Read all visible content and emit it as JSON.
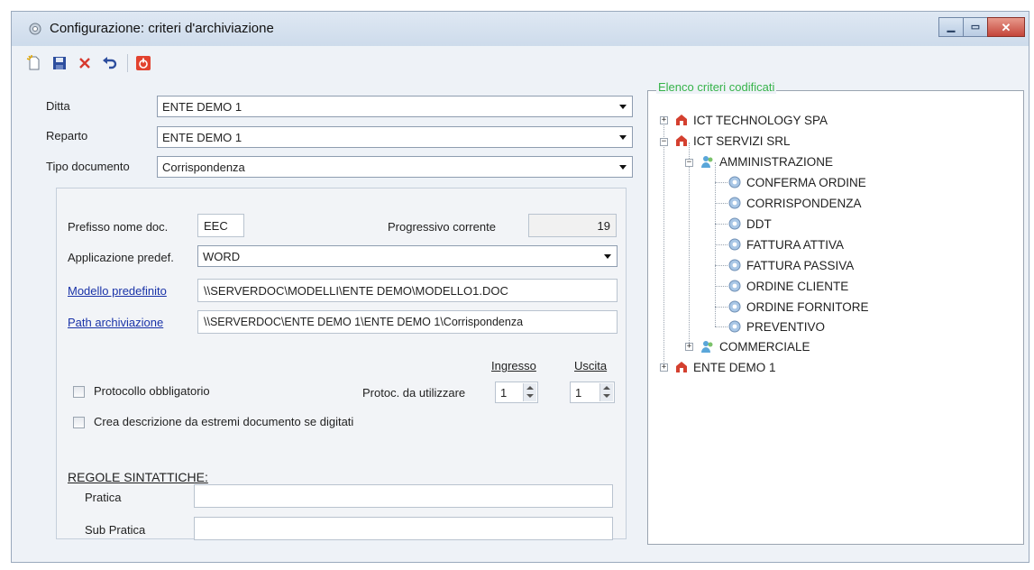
{
  "window": {
    "title": "Configurazione: criteri d'archiviazione"
  },
  "toolbar": {
    "icons": [
      "new-icon",
      "save-icon",
      "delete-icon",
      "undo-icon",
      "exit-icon"
    ]
  },
  "form": {
    "ditta": {
      "label": "Ditta",
      "value": "ENTE DEMO 1"
    },
    "reparto": {
      "label": "Reparto",
      "value": "ENTE DEMO 1"
    },
    "tipo_documento": {
      "label": "Tipo documento",
      "value": "Corrispondenza"
    }
  },
  "details": {
    "prefisso": {
      "label": "Prefisso nome doc.",
      "value": "EEC"
    },
    "progressivo": {
      "label": "Progressivo corrente",
      "value": "19"
    },
    "applicazione": {
      "label": "Applicazione predef.",
      "value": "WORD"
    },
    "modello": {
      "label": "Modello predefinito",
      "value": "\\\\SERVERDOC\\MODELLI\\ENTE DEMO\\MODELLO1.DOC"
    },
    "path": {
      "label": "Path archiviazione",
      "value": "\\\\SERVERDOC\\ENTE DEMO 1\\ENTE DEMO 1\\Corrispondenza"
    },
    "protocollo": {
      "label": "Protocollo obbligatorio",
      "checked": false
    },
    "protoc_utilizzare": {
      "label": "Protoc. da utilizzare",
      "ingresso_header": "Ingresso",
      "uscita_header": "Uscita",
      "ingresso_value": "1",
      "uscita_value": "1"
    },
    "crea_descrizione": {
      "label": "Crea descrizione da estremi documento se digitati",
      "checked": false
    },
    "regole": {
      "title": "REGOLE SINTATTICHE:",
      "pratica_label": "Pratica",
      "pratica_value": "",
      "sub_pratica_label": "Sub Pratica",
      "sub_pratica_value": ""
    }
  },
  "tree": {
    "title": "Elenco criteri codificati",
    "title_color": "#36b34a",
    "nodes": [
      {
        "label": "ICT TECHNOLOGY SPA"
      },
      {
        "label": "ICT SERVIZI SRL"
      },
      {
        "label": "AMMINISTRAZIONE"
      },
      {
        "label": "CONFERMA ORDINE"
      },
      {
        "label": "CORRISPONDENZA"
      },
      {
        "label": "DDT"
      },
      {
        "label": "FATTURA ATTIVA"
      },
      {
        "label": "FATTURA PASSIVA"
      },
      {
        "label": "ORDINE CLIENTE"
      },
      {
        "label": "ORDINE FORNITORE"
      },
      {
        "label": "PREVENTIVO"
      },
      {
        "label": "COMMERCIALE"
      },
      {
        "label": "ENTE DEMO 1"
      }
    ]
  },
  "colors": {
    "link": "#1a33a8",
    "close": "#c4453a"
  }
}
